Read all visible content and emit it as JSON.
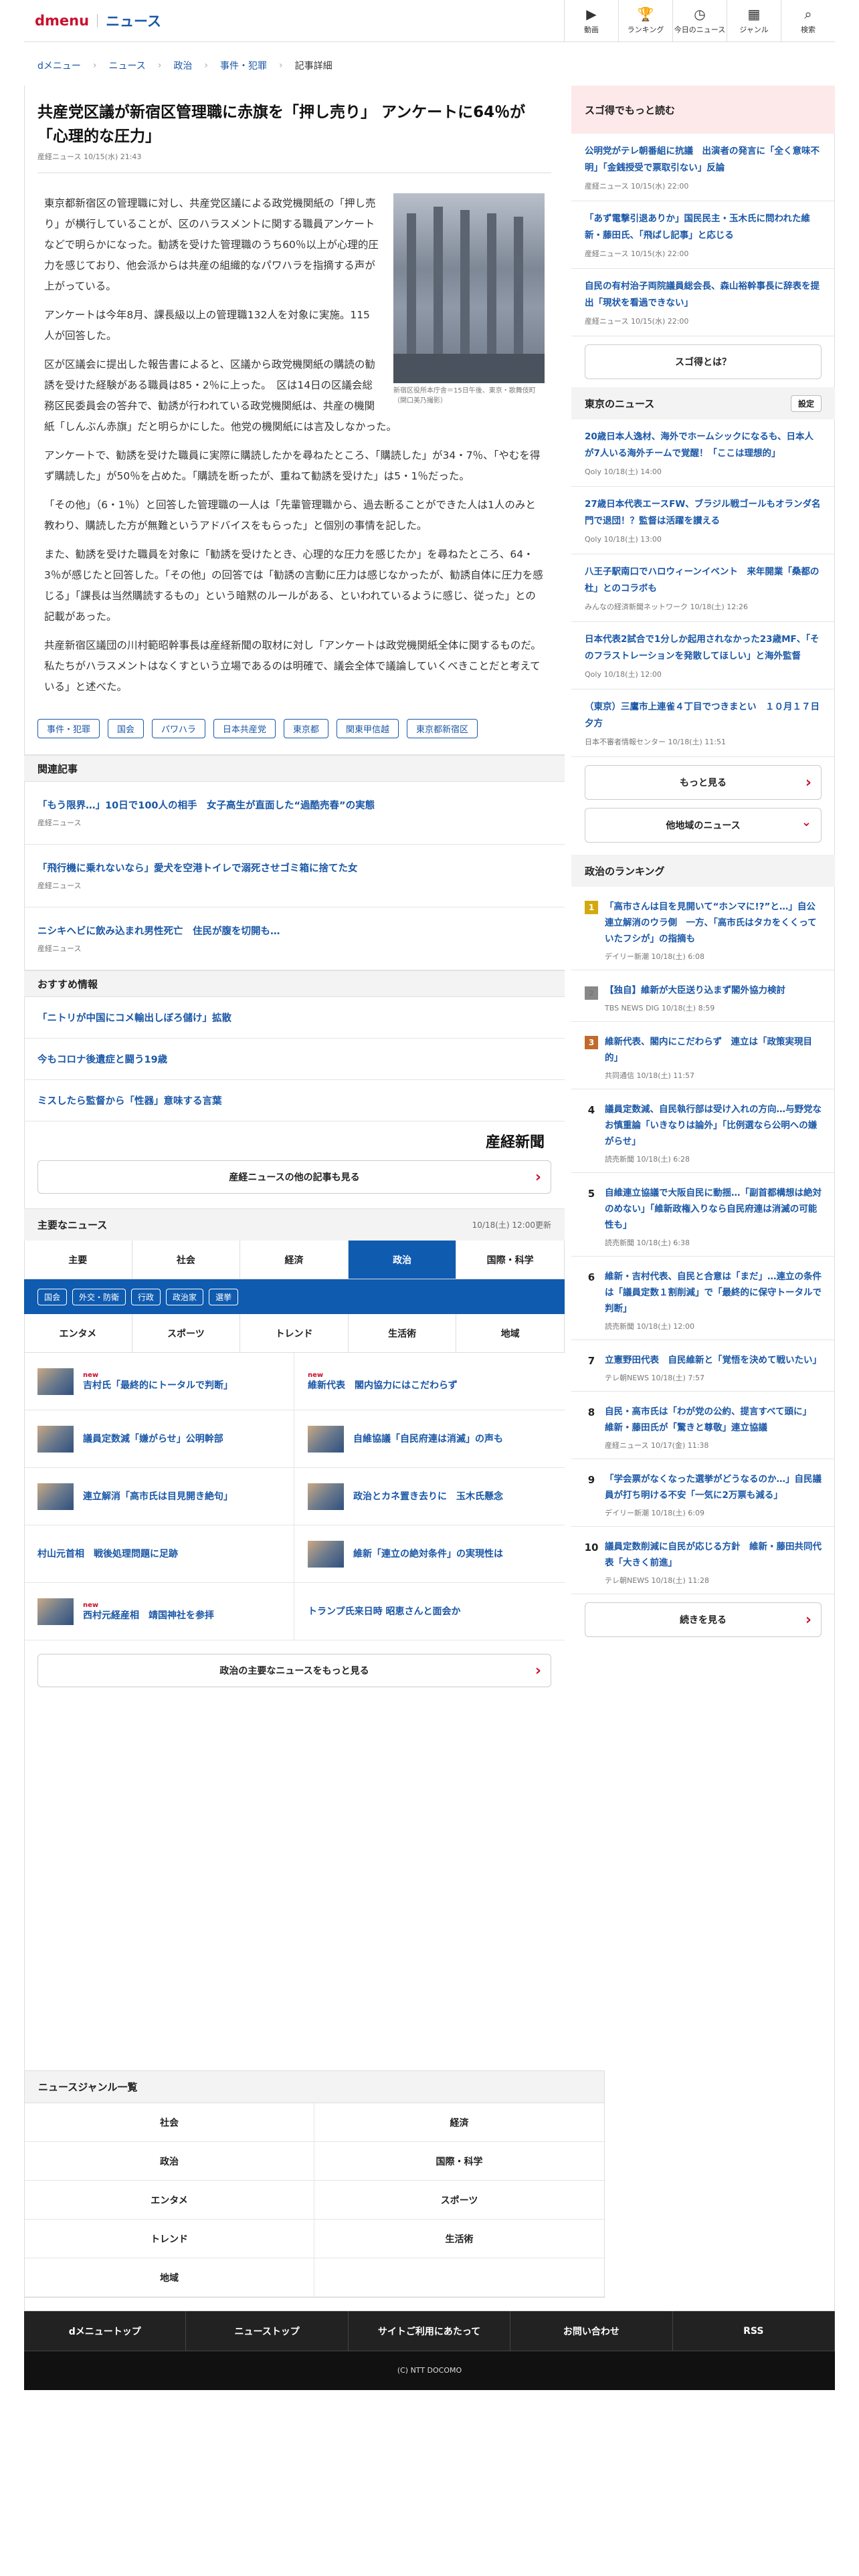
{
  "header": {
    "brand": "dmenu",
    "section": "ニュース",
    "nav": [
      {
        "icon": "video-icon",
        "glyph": "▶",
        "label": "動画"
      },
      {
        "icon": "trophy-icon",
        "glyph": "🏆",
        "label": "ランキング"
      },
      {
        "icon": "clock-icon",
        "glyph": "◷",
        "label": "今日のニュース"
      },
      {
        "icon": "grid-icon",
        "glyph": "▦",
        "label": "ジャンル"
      },
      {
        "icon": "search-icon",
        "glyph": "⌕",
        "label": "検索"
      }
    ]
  },
  "breadcrumb": [
    "dメニュー",
    "ニュース",
    "政治",
    "事件・犯罪",
    "記事詳細"
  ],
  "article": {
    "title": "共産党区議が新宿区管理職に赤旗を「押し売り」 アンケートに64％が「心理的な圧力」",
    "meta": "産経ニュース 10/15(水) 21:43",
    "photo_caption": "新宿区役所本庁舎＝15日午後、東京・歌舞伎町（関口美乃撮影）",
    "paragraphs": [
      "東京都新宿区の管理職に対し、共産党区議による政党機関紙の「押し売り」が横行していることが、区のハラスメントに関する職員アンケートなどで明らかになった。勧誘を受けた管理職のうち60％以上が心理的圧力を感じており、他会派からは共産の組織的なパワハラを指摘する声が上がっている。",
      "アンケートは今年8月、課長級以上の管理職132人を対象に実施。115人が回答した。",
      "区が区議会に提出した報告書によると、区議から政党機関紙の購読の勧誘を受けた経験がある職員は85・2％に上った。　区は14日の区議会総務区民委員会の答弁で、勧誘が行われている政党機関紙は、共産の機関紙「しんぶん赤旗」だと明らかにした。他党の機関紙には言及しなかった。",
      "アンケートで、勧誘を受けた職員に実際に購読したかを尋ねたところ、「購読した」が34・7％、「やむを得ず購読した」が50％を占めた。「購読を断ったが、重ねて勧誘を受けた」は5・1％だった。",
      "「その他」（6・1％）と回答した管理職の一人は「先輩管理職から、過去断ることができた人は1人のみと教わり、購読した方が無難というアドバイスをもらった」と個別の事情を記した。",
      "また、勧誘を受けた職員を対象に「勧誘を受けたとき、心理的な圧力を感じたか」を尋ねたところ、64・3％が感じたと回答した。「その他」の回答では「勧誘の言動に圧力は感じなかったが、勧誘自体に圧力を感じる」「課長は当然購読するもの」という暗黙のルールがある、といわれているように感じ、従った」との記載があった。",
      "共産新宿区議団の川村範昭幹事長は産経新聞の取材に対し「アンケートは政党機関紙全体に関するものだ。私たちがハラスメントはなくすという立場であるのは明確で、議会全体で議論していくべきことだと考えている」と述べた。"
    ],
    "tags": [
      "事件・犯罪",
      "国会",
      "パワハラ",
      "日本共産党",
      "東京都",
      "関東甲信越",
      "東京都新宿区"
    ]
  },
  "related": {
    "heading": "関連記事",
    "items": [
      {
        "title": "「もう限界…」10日で100人の相手　女子高生が直面した“過酷売春”の実態",
        "source": "産経ニュース"
      },
      {
        "title": "「飛行機に乗れないなら」愛犬を空港トイレで溺死させゴミ箱に捨てた女",
        "source": "産経ニュース"
      },
      {
        "title": "ニシキヘビに飲み込まれ男性死亡　住民が腹を切開も…",
        "source": "産経ニュース"
      }
    ]
  },
  "recommend": {
    "heading": "おすすめ情報",
    "items": [
      "「ニトリが中国にコメ輸出しぼろ儲け」拡散",
      "今もコロナ後遺症と闘う19歳",
      "ミスしたら監督から「性器」意味する言葉"
    ]
  },
  "publisher_logo": "産経新聞",
  "more_publisher_button": "産経ニュースの他の記事も見る",
  "major": {
    "heading": "主要なニュース",
    "updated": "10/18(土) 12:00更新",
    "tabs1": [
      "主要",
      "社会",
      "経済",
      "政治",
      "国際・科学"
    ],
    "active_tab": "政治",
    "subtabs": [
      "国会",
      "外交・防衛",
      "行政",
      "政治家",
      "選挙"
    ],
    "tabs2": [
      "エンタメ",
      "スポーツ",
      "トレンド",
      "生活術",
      "地域"
    ],
    "items": [
      {
        "title": "吉村氏「最終的にトータルで判断」",
        "new": "new",
        "thumb": true
      },
      {
        "title": "維新代表　閣内協力にはこだわらず",
        "new": "new",
        "thumb": false
      },
      {
        "title": "議員定数減「嫌がらせ」公明幹部",
        "new": "",
        "thumb": true
      },
      {
        "title": "自維協議「自民府連は消滅」の声も",
        "new": "",
        "thumb": true
      },
      {
        "title": "連立解消「高市氏は目見開き絶句」",
        "new": "",
        "thumb": true
      },
      {
        "title": "政治とカネ置き去りに　玉木氏懸念",
        "new": "",
        "thumb": true
      },
      {
        "title": "村山元首相　戦後処理問題に足跡",
        "new": "",
        "thumb": false
      },
      {
        "title": "維新「連立の絶対条件」の実現性は",
        "new": "",
        "thumb": true
      },
      {
        "title": "西村元経産相　靖国神社を参拝",
        "new": "new",
        "thumb": true
      },
      {
        "title": "トランプ氏来日時 昭恵さんと面会か",
        "new": "",
        "thumb": false
      }
    ],
    "more_button": "政治の主要なニュースをもっと見る"
  },
  "genre": {
    "heading": "ニュースジャンル一覧",
    "items": [
      "社会",
      "経済",
      "政治",
      "国際・科学",
      "エンタメ",
      "スポーツ",
      "トレンド",
      "生活術",
      "地域"
    ]
  },
  "footer": {
    "links": [
      "dメニュートップ",
      "ニューストップ",
      "サイトご利用にあたって",
      "お問い合わせ",
      "RSS"
    ],
    "copyright": "(C) NTT DOCOMO"
  },
  "sidebar": {
    "sugotoku": {
      "heading": "スゴ得でもっと読む",
      "items": [
        {
          "title": "公明党がテレ朝番組に抗議　出演者の発言に「全く意味不明」「金銭授受で票取引ない」反論",
          "source": "産経ニュース 10/15(水) 22:00"
        },
        {
          "title": "「あず電撃引退ありか」国民民主・玉木氏に問われた維新・藤田氏、「飛ばし記事」と応じる",
          "source": "産経ニュース 10/15(水) 22:00"
        },
        {
          "title": "自民の有村治子両院議員総会長、森山裕幹事長に辞表を提出「現状を看過できない」",
          "source": "産経ニュース 10/15(水) 22:00"
        }
      ],
      "button": "スゴ得とは？"
    },
    "tokyo": {
      "heading": "東京のニュース",
      "setting": "設定",
      "items": [
        {
          "title": "20歳日本人逸材、海外でホームシックになるも、日本人が7人いる海外チームで覚醒！「ここは理想的」",
          "source": "Qoly 10/18(土) 14:00"
        },
        {
          "title": "27歳日本代表エースFW、ブラジル戦ゴールもオランダ名門で退団！？監督は活躍を讃える",
          "source": "Qoly 10/18(土) 13:00"
        },
        {
          "title": "八王子駅南口でハロウィーンイベント　来年開業「桑都の杜」とのコラボも",
          "source": "みんなの経済新聞ネットワーク 10/18(土) 12:26"
        },
        {
          "title": "日本代表2試合で1分しか起用されなかった23歳MF、「そのフラストレーションを発散してほしい」と海外監督",
          "source": "Qoly 10/18(土) 12:00"
        },
        {
          "title": "（東京）三鷹市上連雀４丁目でつきまとい　１０月１７日夕方",
          "source": "日本不審者情報センター 10/18(土) 11:51"
        }
      ],
      "more": "もっと見る",
      "other": "他地域のニュース"
    },
    "ranking": {
      "heading": "政治のランキング",
      "items": [
        {
          "n": "1",
          "title": "「高市さんは目を見開いて“ホンマに!?”と…」自公連立解消のウラ側　一方、「高市氏はタカをくくっていたフシが」の指摘も",
          "source": "デイリー新潮 10/18(土) 6:08"
        },
        {
          "n": "2",
          "title": "【独自】維新が大臣送り込まず閣外協力検討",
          "source": "TBS NEWS DIG 10/18(土) 8:59"
        },
        {
          "n": "3",
          "title": "維新代表、閣内にこだわらず　連立は「政策実現目的」",
          "source": "共同通信 10/18(土) 11:57"
        },
        {
          "n": "4",
          "title": "議員定数減、自民執行部は受け入れの方向…与野党なお慎重論「いきなりは論外」「比例選なら公明への嫌がらせ」",
          "source": "読売新聞 10/18(土) 6:28"
        },
        {
          "n": "5",
          "title": "自維連立協議で大阪自民に動揺…「副首都構想は絶対のめない」「維新政権入りなら自民府連は消滅の可能性も」",
          "source": "読売新聞 10/18(土) 6:38"
        },
        {
          "n": "6",
          "title": "維新・吉村代表、自民と合意は「まだ」…連立の条件は「議員定数１割削減」で「最終的に保守トータルで判断」",
          "source": "読売新聞 10/18(土) 12:00"
        },
        {
          "n": "7",
          "title": "立憲野田代表　自民維新と「覚悟を決めて戦いたい」",
          "source": "テレ朝NEWS 10/18(土) 7:57"
        },
        {
          "n": "8",
          "title": "自民・高市氏は「わが党の公約、提言すべて頭に」　維新・藤田氏が「驚きと尊敬」連立協議",
          "source": "産経ニュース 10/17(金) 11:38"
        },
        {
          "n": "9",
          "title": "「学会票がなくなった選挙がどうなるのか…」自民議員が打ち明ける不安「一気に2万票も減る」",
          "source": "デイリー新潮 10/18(土) 6:09"
        },
        {
          "n": "10",
          "title": "議員定数削減に自民が応じる方針　維新・藤田共同代表「大きく前進」",
          "source": "テレ朝NEWS 10/18(土) 11:28"
        }
      ],
      "more": "続きを見る"
    }
  }
}
